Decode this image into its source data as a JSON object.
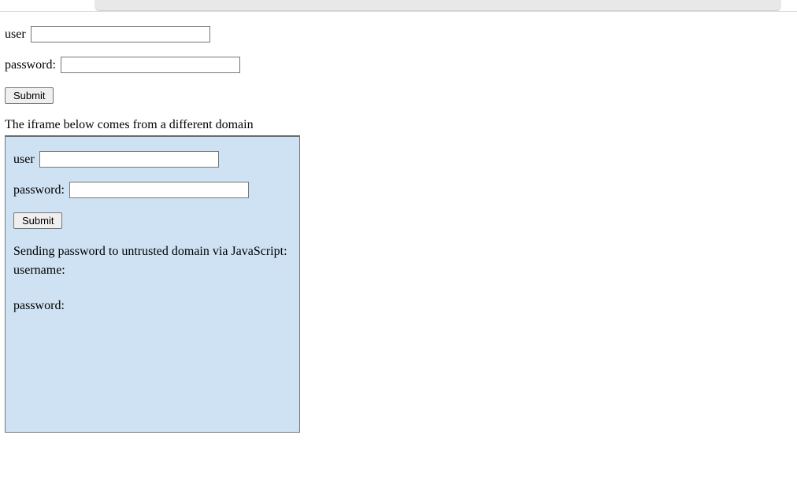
{
  "main_form": {
    "user_label": "user",
    "user_value": "",
    "password_label": "password:",
    "password_value": "",
    "submit_label": "Submit"
  },
  "intro_text": "The iframe below comes from a different domain",
  "iframe": {
    "user_label": "user",
    "user_value": "",
    "password_label": "password:",
    "password_value": "",
    "submit_label": "Submit",
    "status_heading": "Sending password to untrusted domain via JavaScript:",
    "username_line": "username:",
    "password_line": "password:"
  }
}
